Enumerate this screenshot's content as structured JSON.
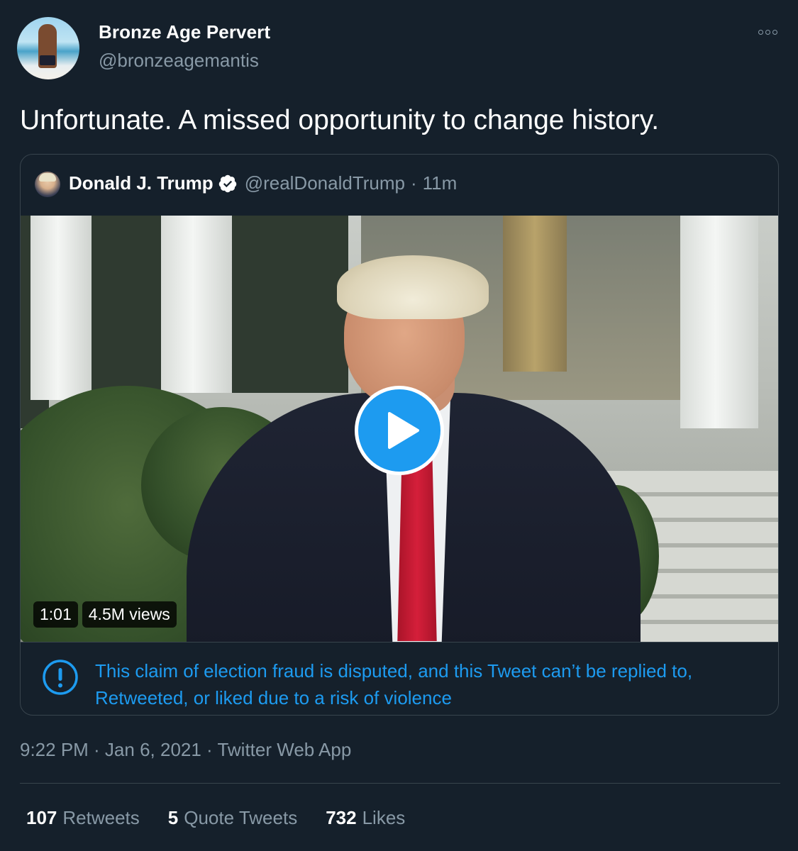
{
  "tweet": {
    "author_name": "Bronze Age Pervert",
    "author_handle": "@bronzeagemantis",
    "text": "Unfortunate. A missed opportunity to change history.",
    "timestamp": "9:22 PM · Jan 6, 2021 · Twitter Web App",
    "more_icon": "more-horizontal-icon"
  },
  "quoted_tweet": {
    "author_name": "Donald J. Trump",
    "verified_icon": "verified-badge-icon",
    "author_handle": "@realDonaldTrump",
    "separator": "·",
    "time_ago": "11m",
    "video": {
      "duration": "1:01",
      "views": "4.5M views",
      "play_icon": "play-icon"
    },
    "notice": {
      "icon": "alert-circle-icon",
      "text": "This claim of election fraud is disputed, and this Tweet can’t be replied to, Retweeted, or liked due to a risk of violence"
    }
  },
  "stats": [
    {
      "count": "107",
      "label": "Retweets"
    },
    {
      "count": "5",
      "label": "Quote Tweets"
    },
    {
      "count": "732",
      "label": "Likes"
    }
  ],
  "colors": {
    "background": "#15202b",
    "secondary_text": "#8899a6",
    "accent": "#1d9bf0",
    "border": "#38444d"
  }
}
